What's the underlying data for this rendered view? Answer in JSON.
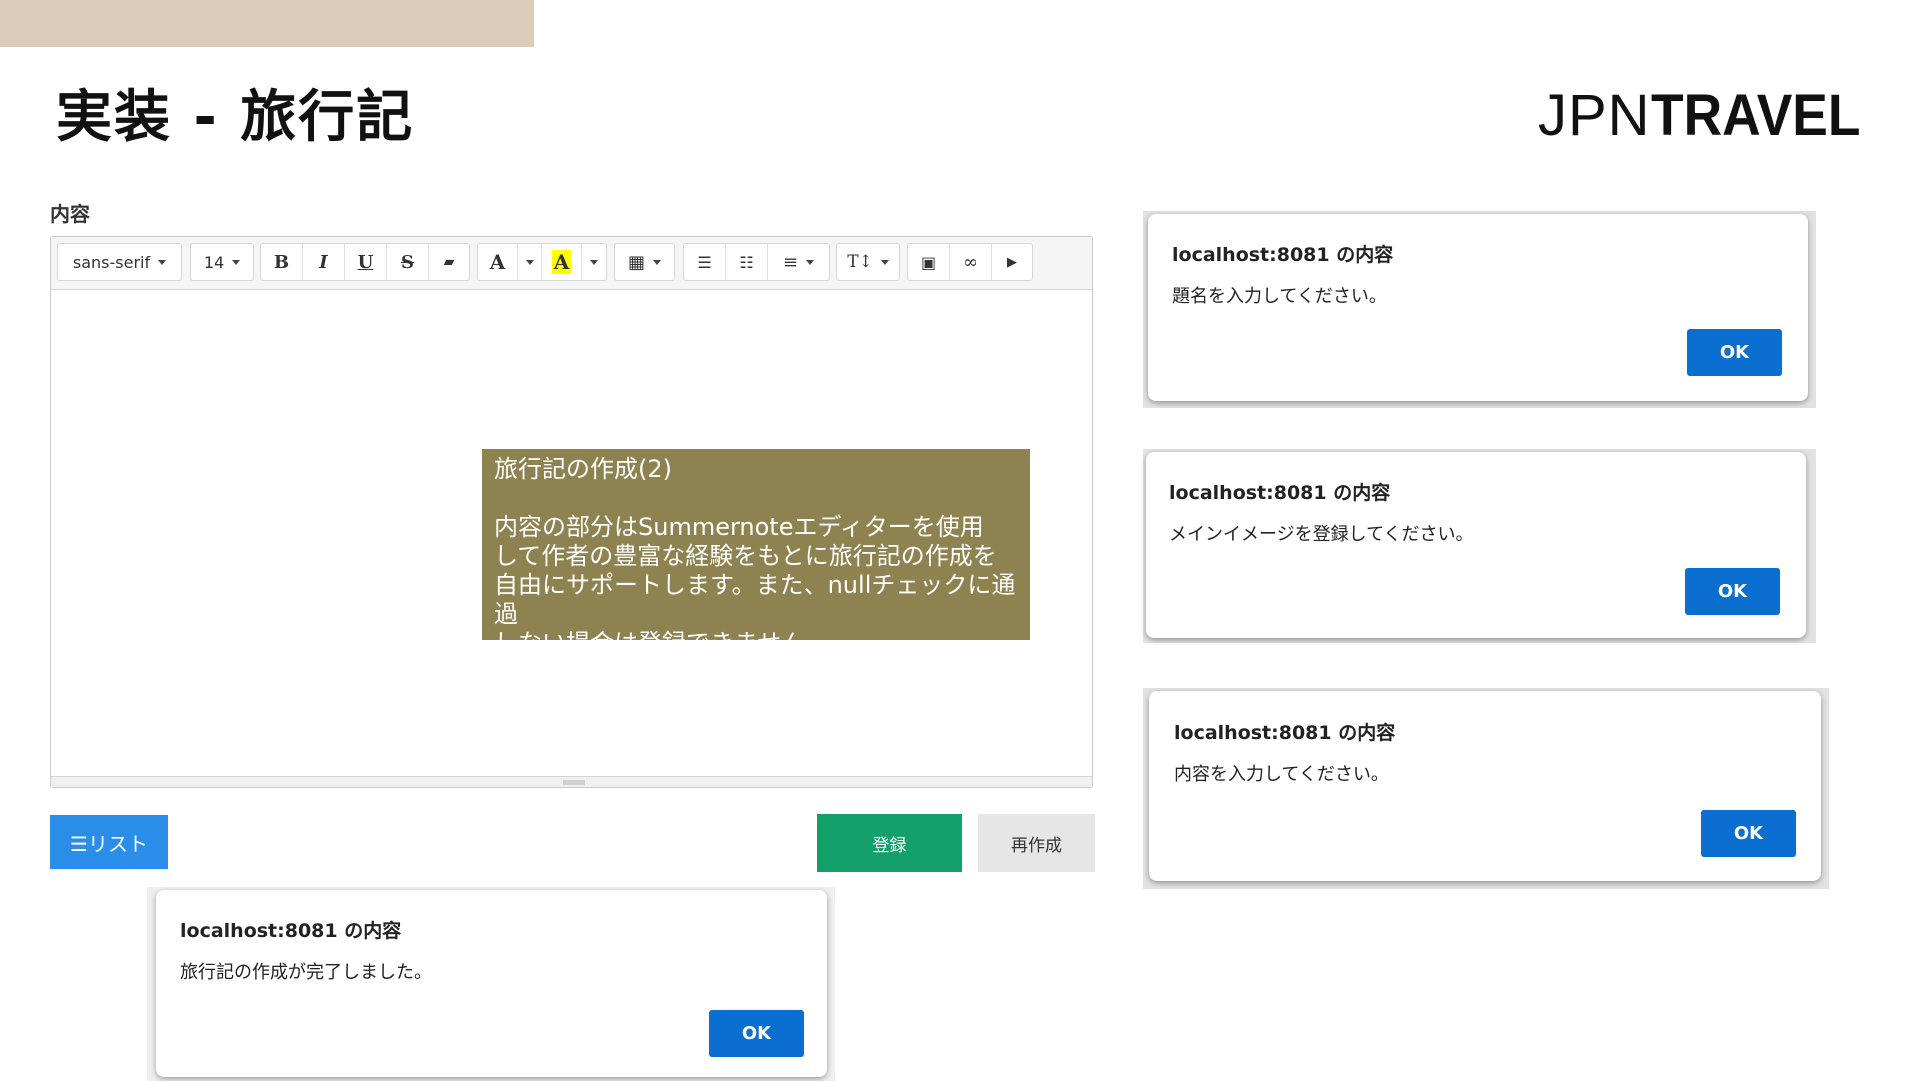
{
  "slide": {
    "title": "実装 - 旅行記",
    "logo_light": "JPN",
    "logo_bold": "TRAVEL"
  },
  "form": {
    "content_label": "内容",
    "list_button": "☰リスト",
    "submit_button": "登録",
    "reset_button": "再作成"
  },
  "editor": {
    "font_family": "sans-serif",
    "font_size": "14",
    "bold": "B",
    "italic": "I",
    "underline": "U",
    "strike": "S",
    "eraser": "▰",
    "fore_color": "A",
    "back_color": "A",
    "table": "▦",
    "ul": "☰",
    "ol": "☷",
    "align": "≡",
    "height": "T↕",
    "picture": "▣",
    "link": "∞",
    "video": "▶"
  },
  "callout": {
    "title": "旅行記の作成(2)",
    "lines": [
      "内容の部分はSummernoteエディターを使用",
      "して作者の豊富な経験をもとに旅行記の作成を",
      "自由にサポートします。また、nullチェックに通過",
      "しない場合は登録できません。"
    ]
  },
  "dialogs": [
    {
      "title": "localhost:8081 の内容",
      "message": "旅行記の作成が完了しました。",
      "ok": "OK"
    },
    {
      "title": "localhost:8081 の内容",
      "message": "題名を入力してください。",
      "ok": "OK"
    },
    {
      "title": "localhost:8081 の内容",
      "message": "メインイメージを登録してください。",
      "ok": "OK"
    },
    {
      "title": "localhost:8081 の内容",
      "message": "内容を入力してください。",
      "ok": "OK"
    }
  ],
  "colors": {
    "top_band": "#dccbb8",
    "callout_bg": "#8e8350",
    "list_button": "#2a8ee8",
    "submit_button": "#14a06a",
    "ok_button": "#0b6ed1",
    "highlight_yellow": "#ffff00"
  }
}
